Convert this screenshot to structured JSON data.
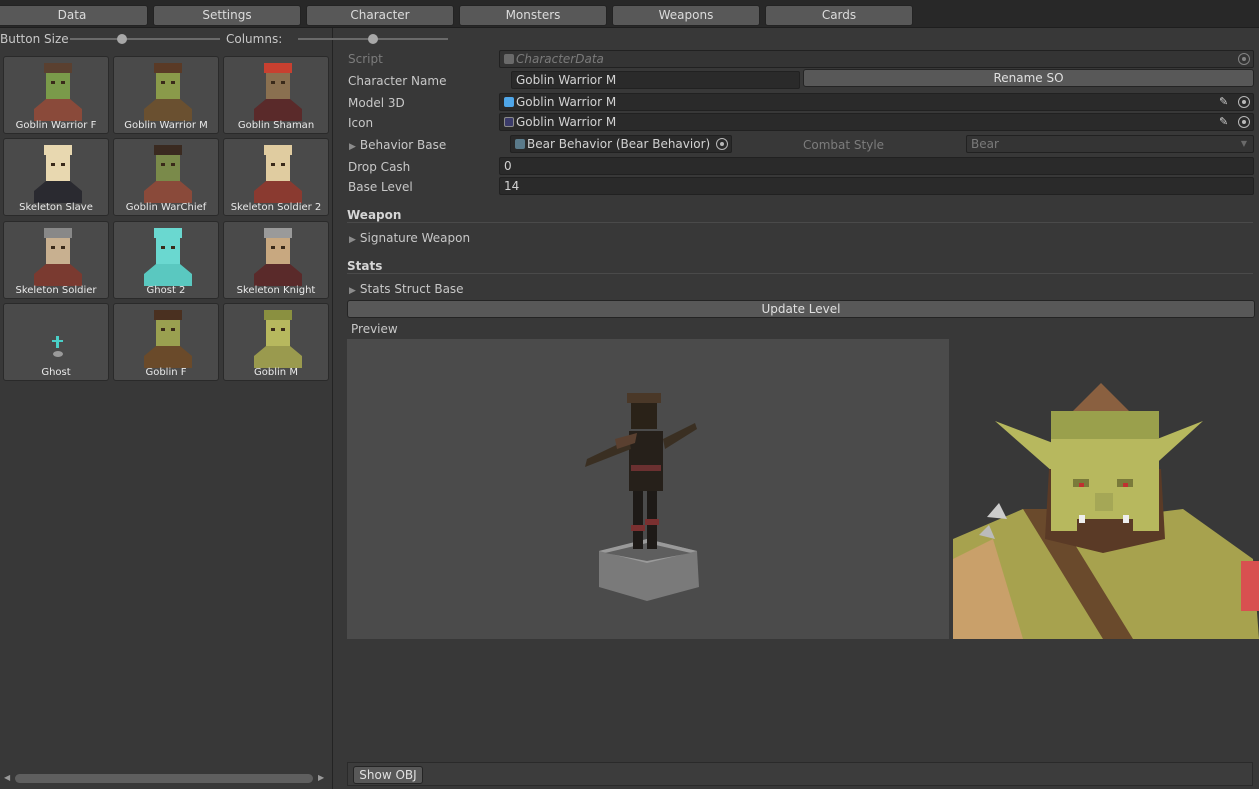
{
  "tabs": [
    "Data",
    "Settings",
    "Character",
    "Monsters",
    "Weapons",
    "Cards"
  ],
  "left_panel": {
    "button_size_label": "Button Size",
    "columns_label": "Columns:",
    "items": [
      {
        "label": "Goblin Warrior F"
      },
      {
        "label": "Goblin Warrior M"
      },
      {
        "label": "Goblin Shaman"
      },
      {
        "label": "Skeleton Slave"
      },
      {
        "label": "Goblin WarChief"
      },
      {
        "label": "Skeleton Soldier 2"
      },
      {
        "label": "Skeleton Soldier"
      },
      {
        "label": "Ghost 2"
      },
      {
        "label": "Skeleton Knight"
      },
      {
        "label": "Ghost"
      },
      {
        "label": "Goblin F"
      },
      {
        "label": "Goblin M"
      }
    ]
  },
  "inspector": {
    "script_label": "Script",
    "script_value": "CharacterData",
    "character_name_label": "Character Name",
    "character_name_value": "Goblin Warrior M",
    "rename_button": "Rename SO",
    "model_label": "Model 3D",
    "model_value": "Goblin Warrior M",
    "icon_label": "Icon",
    "icon_value": "Goblin Warrior M",
    "behavior_label": "Behavior Base",
    "behavior_value": "Bear Behavior (Bear Behavior)",
    "combat_style_label": "Combat Style",
    "combat_style_value": "Bear",
    "drop_cash_label": "Drop Cash",
    "drop_cash_value": "0",
    "base_level_label": "Base Level",
    "base_level_value": "14",
    "weapon_header": "Weapon",
    "signature_weapon_label": "Signature Weapon",
    "stats_header": "Stats",
    "stats_struct_label": "Stats Struct Base",
    "update_level_button": "Update Level",
    "preview_label": "Preview",
    "show_obj_button": "Show OBJ"
  },
  "colors": {
    "background": "#383838",
    "field": "#2a2a2a",
    "button": "#585858",
    "preview_bg": "#4b4b4b",
    "goblin_skin": "#b7b85e"
  }
}
